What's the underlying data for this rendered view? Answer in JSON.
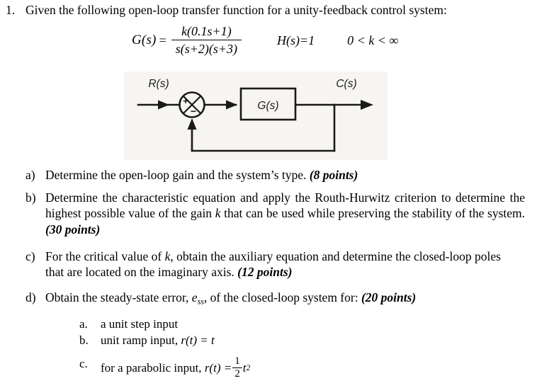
{
  "question": {
    "number": "1.",
    "stem": "Given the following open-loop transfer function for a unity-feedback control system:"
  },
  "equation": {
    "lhs": "G(s)",
    "equals": "=",
    "numerator": "k(0.1s+1)",
    "denominator": "s(s+2)(s+3)",
    "feedback": "H(s)=1",
    "gain_range": "0 < k < ∞"
  },
  "diagram": {
    "name": "unity-feedback-block-diagram",
    "input_label": "R(s)",
    "output_label": "C(s)",
    "block_label": "G(s)",
    "summing_plus": "+",
    "summing_minus": "−",
    "background_color": "#f7f5f1",
    "line_color": "#1a1a1a"
  },
  "parts": [
    {
      "marker": "a)",
      "text": "Determine the open-loop gain and the system’s type.",
      "points": "(8 points)"
    },
    {
      "marker": "b)",
      "text_1": "Determine the characteristic equation and apply the Routh-Hurwitz criterion to determine the highest possible value of the gain",
      "symbol": "k",
      "text_2": "that can be used while preserving the stability of the system.",
      "points": "(30 points)"
    },
    {
      "marker": "c)",
      "text_1": "For the critical value of",
      "symbol": "k",
      "text_2": ", obtain the auxiliary equation and determine the closed-loop poles that are located on the imaginary axis.",
      "points": "(12 points)"
    },
    {
      "marker": "d)",
      "text_1": "Obtain the steady-state error,",
      "symbol": "e",
      "symbol_sub": "ss",
      "text_2": ", of the closed-loop system for:",
      "points": "(20 points)"
    }
  ],
  "sub_items": [
    {
      "marker": "a.",
      "text": "a unit step input"
    },
    {
      "marker": "b.",
      "text": "unit ramp input,",
      "formula": "r(t) = t"
    },
    {
      "marker": "c.",
      "text": "for a parabolic input,",
      "formula_lhs": "r(t) =",
      "formula_num": "1",
      "formula_den": "2",
      "formula_tail": "t",
      "formula_exp": "2"
    }
  ]
}
